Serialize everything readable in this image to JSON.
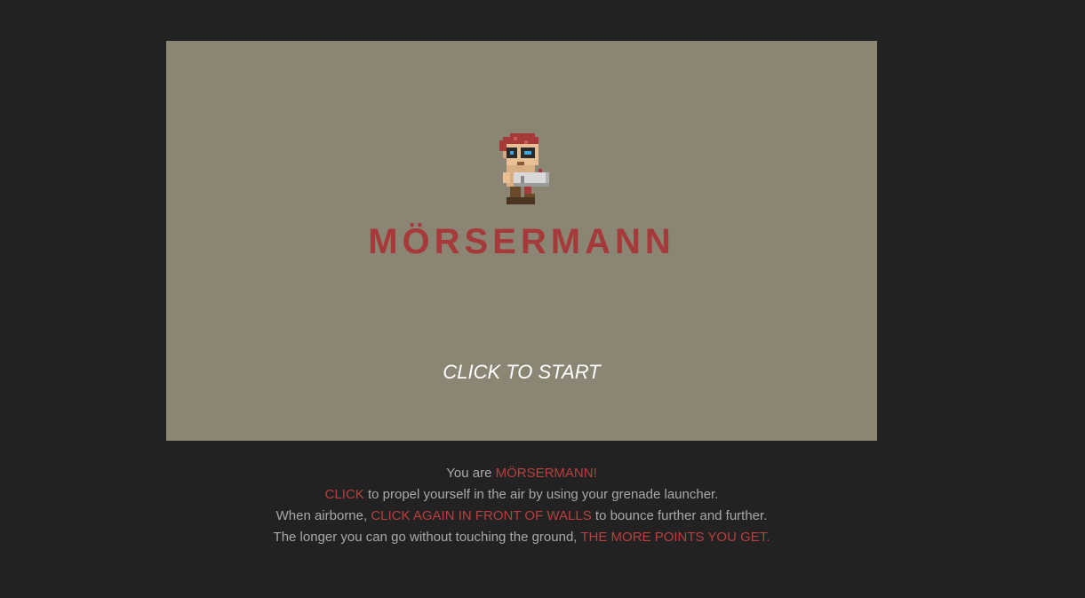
{
  "game": {
    "title": "MÖRSERMANN",
    "start_prompt": "CLICK TO START",
    "character_icon": "grenadier-character-icon"
  },
  "instructions": {
    "line1": {
      "pre": "You are ",
      "hl": "MÖRSERMANN!",
      "post": ""
    },
    "line2": {
      "pre": "",
      "hl": "CLICK",
      "post": " to propel yourself in the air by using your grenade launcher."
    },
    "line3": {
      "pre": "When airborne, ",
      "hl": "CLICK AGAIN IN FRONT OF WALLS",
      "post": " to bounce further and further."
    },
    "line4": {
      "pre": "The longer you can go without touching the ground, ",
      "hl": "THE MORE POINTS YOU GET.",
      "post": ""
    }
  },
  "colors": {
    "page_bg": "#222222",
    "game_bg": "#8b8573",
    "accent": "#a63a3a",
    "text": "#a8a8a8",
    "start_text": "#ffffff"
  }
}
